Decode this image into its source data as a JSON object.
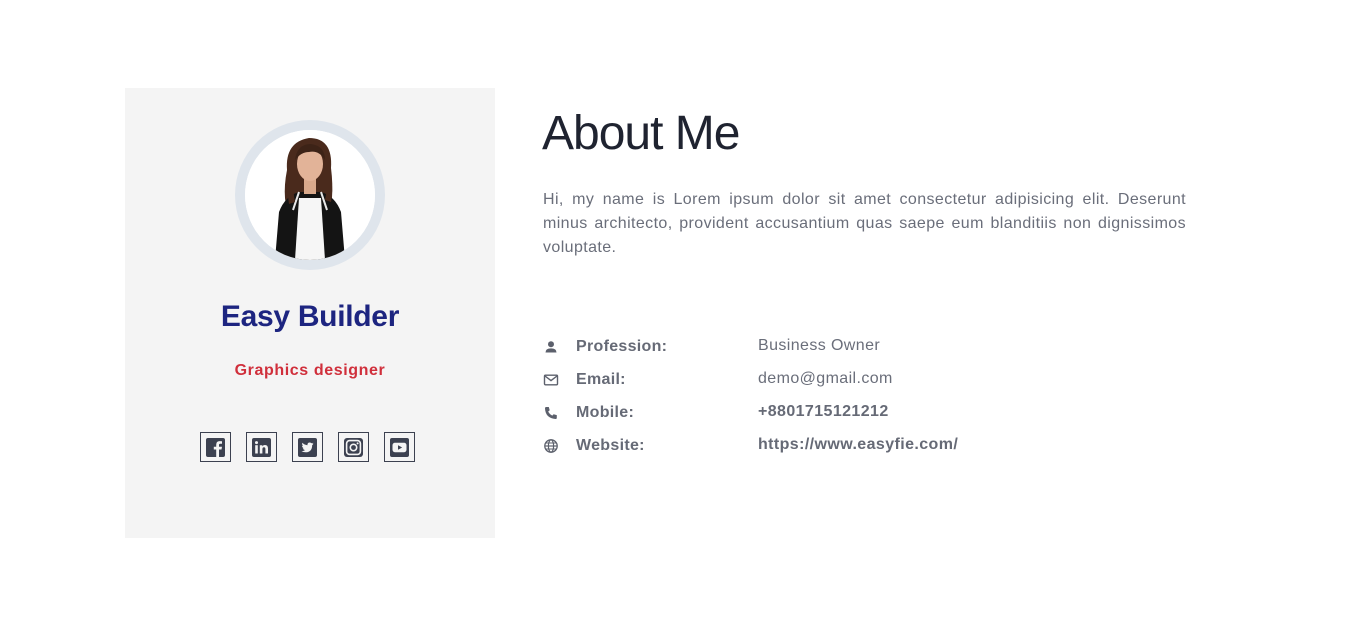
{
  "profile": {
    "name": "Easy Builder",
    "role": "Graphics designer",
    "avatar_alt": "profile photo",
    "social": [
      {
        "name": "facebook",
        "icon": "facebook-icon"
      },
      {
        "name": "linkedin",
        "icon": "linkedin-icon"
      },
      {
        "name": "twitter",
        "icon": "twitter-icon"
      },
      {
        "name": "instagram",
        "icon": "instagram-icon"
      },
      {
        "name": "youtube",
        "icon": "youtube-icon"
      }
    ]
  },
  "about": {
    "title": "About Me",
    "text": "Hi, my name is Lorem ipsum dolor sit amet consectetur adipisicing elit. Deserunt minus architecto, provident accusantium quas saepe eum blanditiis non dignissimos voluptate."
  },
  "info": [
    {
      "icon": "person-icon",
      "label": "Profession:",
      "value": "Business Owner"
    },
    {
      "icon": "mail-icon",
      "label": "Email:",
      "value": "demo@gmail.com"
    },
    {
      "icon": "phone-icon",
      "label": "Mobile:",
      "value": "+8801715121212"
    },
    {
      "icon": "globe-icon",
      "label": "Website:",
      "value": "https://www.easyfie.com/"
    }
  ],
  "colors": {
    "card_bg": "#f4f4f4",
    "name": "#1d2580",
    "role": "#d02f3b",
    "text": "#6a6e7a",
    "title": "#1f2330"
  }
}
